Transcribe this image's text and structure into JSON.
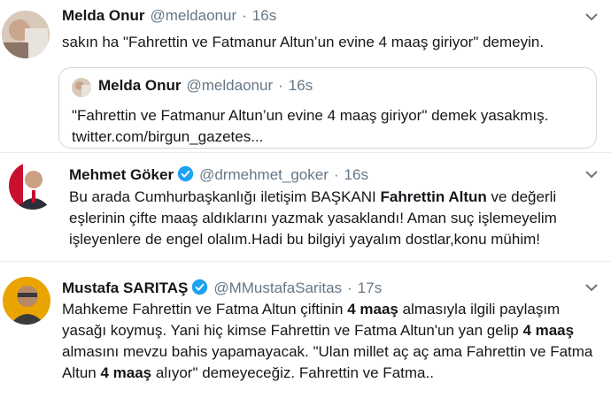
{
  "tweets": [
    {
      "name": "Melda Onur",
      "handle": "@meldaonur",
      "time": "16s",
      "text": "sakın ha \"Fahrettin ve Fatmanur Altun’un evine 4 maaş giriyor\" demeyin.",
      "quote": {
        "name": "Melda Onur",
        "handle": "@meldaonur",
        "time": "16s",
        "line1": "\"Fahrettin ve Fatmanur Altun’un evine 4 maaş giriyor\" demek yasakmış.",
        "line2": "twitter.com/birgun_gazetes..."
      }
    },
    {
      "name": "Mehmet Göker",
      "handle": "@drmehmet_goker",
      "time": "16s",
      "verified": true,
      "line1a": "Bu arada Cumhurbaşkanlığı iletişim BAŞKANI ",
      "line1b": "Fahrettin Altun",
      "line1c": " ve değerli",
      "line2": "eşlerinin çifte maaş aldıklarını yazmak yasaklandı! Aman suç işlemeyelim",
      "line3": "işleyenlere de engel olalım.Hadi bu bilgiyi yayalım dostlar,konu mühim!"
    },
    {
      "name": "Mustafa SARITAŞ",
      "handle": "@MMustafaSaritas",
      "time": "17s",
      "verified": true,
      "line1a": "Mahkeme Fahrettin ve Fatma Altun çiftinin ",
      "line1b": "4 maaş",
      "line1c": " almasıyla ilgili paylaşım",
      "line2a": "yasağı koymuş. Yani hiç kimse Fahrettin ve Fatma Altun'un yan gelip ",
      "line2b": "4 maaş",
      "line3": "almasını mevzu bahis yapamayacak. \"Ulan millet aç aç ama Fahrettin ve Fatma",
      "line4a": "Altun ",
      "line4b": "4 maaş",
      "line4c": " alıyor\" demeyeceğiz. Fahrettin ve Fatma.."
    }
  ],
  "dot": "·",
  "colors": {
    "verified": "#1da1f2",
    "secondary": "#657786",
    "border": "#ccd6dd"
  }
}
